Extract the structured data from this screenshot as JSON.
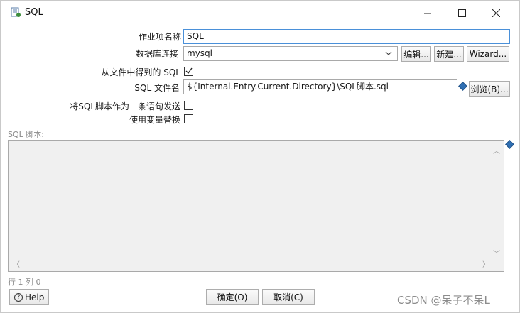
{
  "window": {
    "title": "SQL",
    "controls": {
      "minimize": "—",
      "maximize": "☐",
      "close": "✕"
    }
  },
  "form": {
    "job_item_name": {
      "label": "作业项名称",
      "value": "SQL"
    },
    "db_connection": {
      "label": "数据库连接",
      "value": "mysql",
      "edit_button": "编辑...",
      "new_button": "新建...",
      "wizard_button": "Wizard..."
    },
    "sql_from_file": {
      "label": "从文件中得到的 SQL",
      "checked": true
    },
    "sql_filename": {
      "label": "SQL 文件名",
      "value": "${Internal.Entry.Current.Directory}\\SQL脚本.sql",
      "browse_button": "浏览(B)..."
    },
    "send_as_single_statement": {
      "label": "将SQL脚本作为一条语句发送",
      "checked": false
    },
    "use_variable_substitution": {
      "label": "使用变量替换",
      "checked": false
    }
  },
  "editor": {
    "label": "SQL 脚本:",
    "content": "",
    "position": "行 1 列 0"
  },
  "footer": {
    "help": "Help",
    "ok": "确定(O)",
    "cancel": "取消(C)"
  },
  "watermark": "CSDN @呆子不呆L",
  "colors": {
    "accent": "#4a90d9",
    "diamond": "#2f6fb3",
    "editor_bg": "#f0f0f0"
  }
}
